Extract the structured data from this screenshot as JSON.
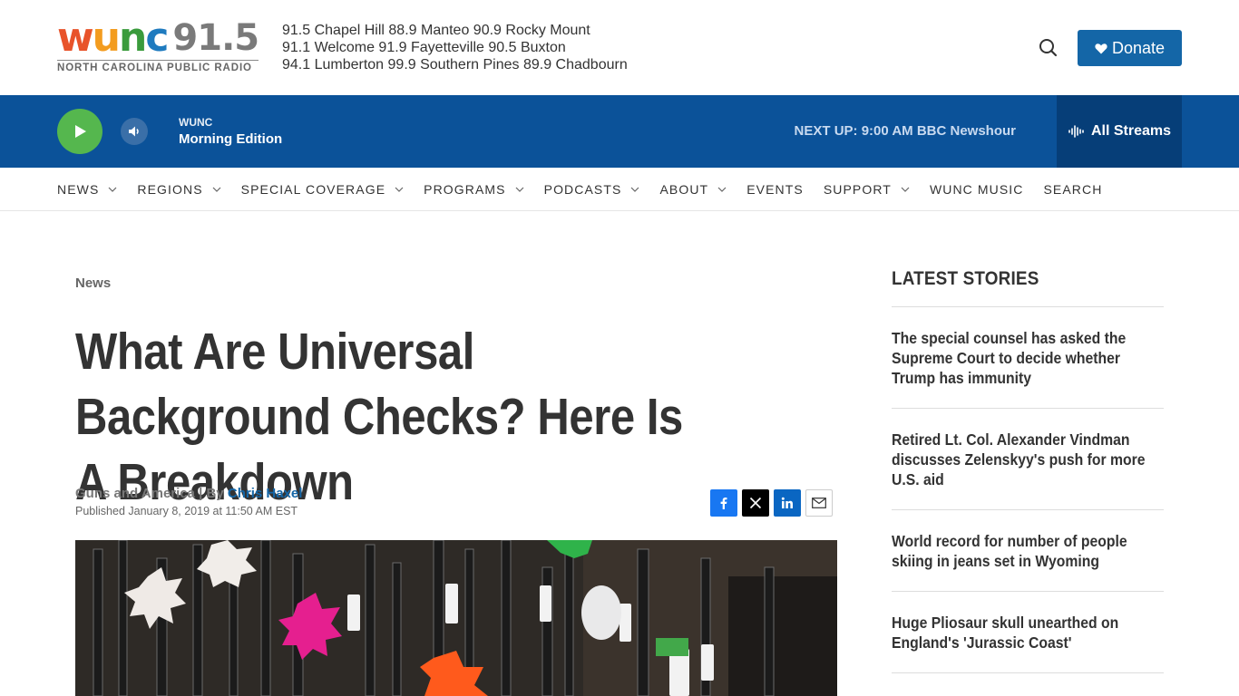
{
  "header": {
    "logo_letters": [
      "w",
      "u",
      "n",
      "c"
    ],
    "logo_number": "91.5",
    "logo_subtitle": "NORTH CAROLINA PUBLIC RADIO",
    "frequencies": [
      "91.5 Chapel Hill   88.9 Manteo   90.9 Rocky Mount",
      "91.1 Welcome   91.9 Fayetteville   90.5 Buxton",
      "94.1 Lumberton  99.9 Southern Pines 89.9 Chadbourn"
    ],
    "donate_label": "Donate",
    "search_icon": "search-icon"
  },
  "player": {
    "station": "WUNC",
    "show": "Morning Edition",
    "next_up": "NEXT UP: 9:00 AM BBC Newshour",
    "all_streams_label": "All Streams"
  },
  "nav": {
    "items": [
      {
        "label": "NEWS",
        "dropdown": true
      },
      {
        "label": "REGIONS",
        "dropdown": true
      },
      {
        "label": "SPECIAL COVERAGE",
        "dropdown": true
      },
      {
        "label": "PROGRAMS",
        "dropdown": true
      },
      {
        "label": "PODCASTS",
        "dropdown": true
      },
      {
        "label": "ABOUT",
        "dropdown": true
      },
      {
        "label": "EVENTS",
        "dropdown": false
      },
      {
        "label": "SUPPORT",
        "dropdown": true
      },
      {
        "label": "WUNC MUSIC",
        "dropdown": false
      },
      {
        "label": "SEARCH",
        "dropdown": false
      }
    ]
  },
  "article": {
    "section": "News",
    "headline": "What Are Universal Background Checks? Here Is A Breakdown",
    "source": "Guns and America",
    "by_prefix": " | By ",
    "author": "Chris Haxel",
    "published": "Published January 8, 2019 at 11:50 AM EST"
  },
  "sidebar": {
    "title": "LATEST STORIES",
    "stories": [
      "The special counsel has asked the Supreme Court to decide whether Trump has immunity",
      "Retired Lt. Col. Alexander Vindman discusses Zelenskyy's push for more U.S. aid",
      "World record for number of people skiing in jeans set in Wyoming",
      "Huge Pliosaur skull unearthed on England's 'Jurassic Coast'"
    ]
  },
  "colors": {
    "brand_blue": "#1466a7",
    "player_bg": "#0b5299",
    "play_green": "#55b74e"
  }
}
